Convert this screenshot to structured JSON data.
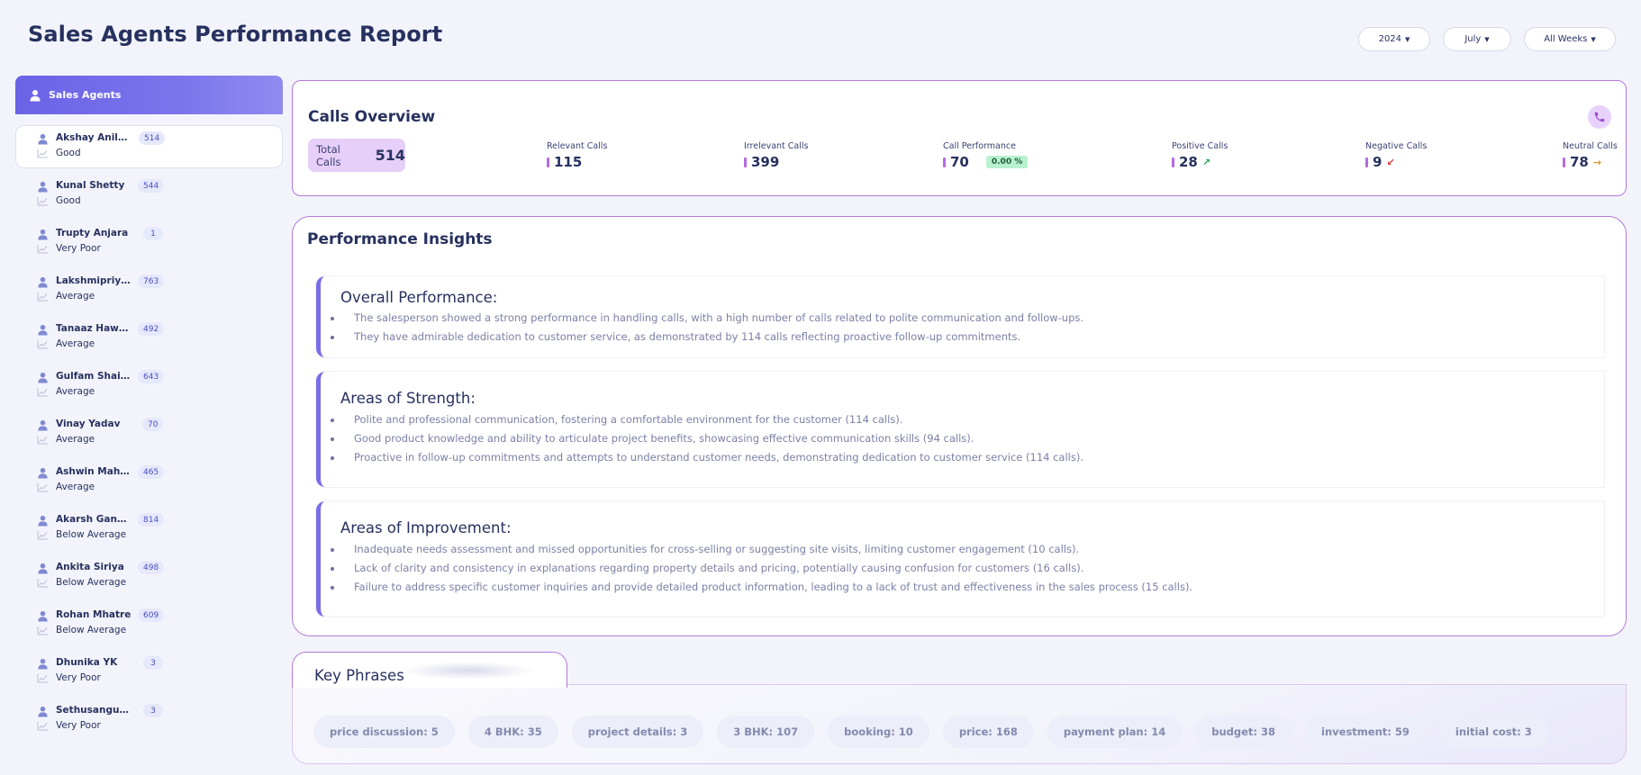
{
  "page": {
    "title": "Sales Agents Performance Report"
  },
  "filters": {
    "year": "2024",
    "month": "July",
    "weeks": "All Weeks"
  },
  "sidebar": {
    "header": "Sales Agents",
    "agents": [
      {
        "name": "Akshay Anilku...",
        "rating": "Good",
        "count": "514",
        "active": true
      },
      {
        "name": "Kunal Shetty",
        "rating": "Good",
        "count": "544"
      },
      {
        "name": "Trupty Anjara",
        "rating": "Very Poor",
        "count": "1"
      },
      {
        "name": "Lakshmipriya S...",
        "rating": "Average",
        "count": "763"
      },
      {
        "name": "Tanaaz Hawal...",
        "rating": "Average",
        "count": "492"
      },
      {
        "name": "Gulfam Shaikh",
        "rating": "Average",
        "count": "643"
      },
      {
        "name": "Vinay Yadav",
        "rating": "Average",
        "count": "70"
      },
      {
        "name": "Ashwin Mahap...",
        "rating": "Average",
        "count": "465"
      },
      {
        "name": "Akarsh Gangan",
        "rating": "Below Average",
        "count": "814"
      },
      {
        "name": "Ankita Siriya",
        "rating": "Below Average",
        "count": "498"
      },
      {
        "name": "Rohan Mhatre",
        "rating": "Below Average",
        "count": "609"
      },
      {
        "name": "Dhunika YK",
        "rating": "Very Poor",
        "count": "3"
      },
      {
        "name": "Sethusanguraja...",
        "rating": "Very Poor",
        "count": "3"
      }
    ]
  },
  "calls": {
    "title": "Calls Overview",
    "total_label": "Total Calls",
    "total": "514",
    "relevant_label": "Relevant Calls",
    "relevant": "115",
    "irrelevant_label": "Irrelevant Calls",
    "irrelevant": "399",
    "performance_label": "Call Performance",
    "performance": "70",
    "performance_pct": "0.00 %",
    "positive_label": "Positive Calls",
    "positive": "28",
    "negative_label": "Negative Calls",
    "negative": "9",
    "neutral_label": "Neutral Calls",
    "neutral": "78",
    "colors": {
      "bar": "#b56be0",
      "positive_arrow": "#2e9c5a",
      "negative_arrow": "#d23a3a",
      "neutral_arrow": "#d69a2a"
    }
  },
  "insights": {
    "title": "Performance Insights",
    "overall": {
      "heading": "Overall Performance:",
      "points": [
        "The salesperson showed a strong performance in handling calls, with a high number of calls related to polite communication and follow-ups.",
        "They have admirable dedication to customer service, as demonstrated by 114 calls reflecting proactive follow-up commitments."
      ]
    },
    "strength": {
      "heading": "Areas of Strength:",
      "points": [
        "Polite and professional communication, fostering a comfortable environment for the customer (114 calls).",
        "Good product knowledge and ability to articulate project benefits, showcasing effective communication skills (94 calls).",
        "Proactive in follow-up commitments and attempts to understand customer needs, demonstrating dedication to customer service (114 calls)."
      ]
    },
    "improvement": {
      "heading": "Areas of Improvement:",
      "points": [
        "Inadequate needs assessment and missed opportunities for cross-selling or suggesting site visits, limiting customer engagement (10 calls).",
        "Lack of clarity and consistency in explanations regarding property details and pricing, potentially causing confusion for customers (16 calls).",
        "Failure to address specific customer inquiries and provide detailed product information, leading to a lack of trust and effectiveness in the sales process (15 calls)."
      ]
    }
  },
  "key_phrases": {
    "title": "Key Phrases",
    "items": [
      "price discussion: 5",
      "4 BHK: 35",
      "project details: 3",
      "3 BHK: 107",
      "booking: 10",
      "price: 168",
      "payment plan: 14",
      "budget: 38",
      "investment: 59",
      "initial cost: 3"
    ]
  }
}
